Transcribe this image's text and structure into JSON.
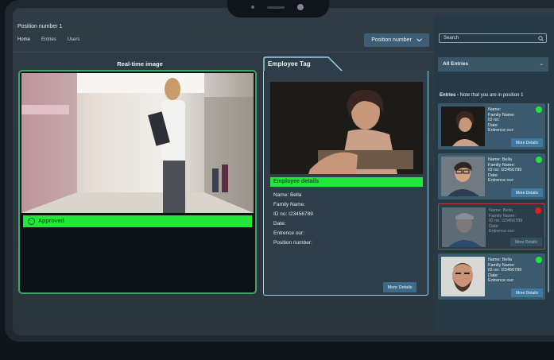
{
  "header": {
    "title": "Position number 1",
    "nav": [
      "Home",
      "Entries",
      "Users"
    ],
    "position_button": "Position number"
  },
  "realtime": {
    "title": "Real-time image",
    "status": "Approved"
  },
  "employee_tag": {
    "title": "Employee Tag",
    "details_header": "Employee details",
    "lines": {
      "name": "Name: Bella",
      "family": "Family Name:",
      "id": "ID no: I23456789",
      "date": "Date:",
      "entrance": "Entrence our:",
      "position": "Position number:"
    },
    "more_button": "More Details"
  },
  "sidebar": {
    "search_placeholder": "Search",
    "dropdown": "All Entries",
    "note_bold": "Entries -",
    "note": " Note that you are in position 1",
    "cards": [
      {
        "name": "Name:",
        "family": "Family Name:",
        "id": "ID no:",
        "date": "Date:",
        "entrance": "Entrence our:",
        "status_color": "#22e63a",
        "more": "More Details"
      },
      {
        "name": "Name: Bella",
        "family": "Family Name:",
        "id": "ID no: I23456789",
        "date": "Date:",
        "entrance": "Entrence our:",
        "status_color": "#22e63a",
        "more": "More Details"
      },
      {
        "name": "Name: Bella",
        "family": "Family Name:",
        "id": "ID no: I23456789",
        "date": "Date:",
        "entrance": "Entrence our:",
        "status_color": "#e11d1d",
        "more": "More Details"
      },
      {
        "name": "Name: Bella",
        "family": "Family Name:",
        "id": "ID no: I23456789",
        "date": "Date:",
        "entrance": "Entrence our:",
        "status_color": "#22e63a",
        "more": "More Details"
      }
    ]
  },
  "colors": {
    "accent": "#3c5d74",
    "approved": "#22e63a",
    "alert": "#e11d1d",
    "tag_border": "#8fd3e8"
  }
}
